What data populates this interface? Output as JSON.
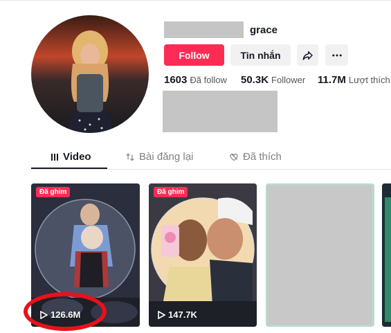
{
  "profile": {
    "username": "grace",
    "follow_label": "Follow",
    "message_label": "Tin nhắn",
    "share_icon": "share-icon",
    "more_icon": "more-icon",
    "stats": [
      {
        "value": "1603",
        "label": "Đã follow"
      },
      {
        "value": "50.3K",
        "label": "Follower"
      },
      {
        "value": "11.7M",
        "label": "Lượt thích"
      }
    ]
  },
  "tabs": [
    {
      "label": "Video",
      "icon": "grid-icon",
      "active": true
    },
    {
      "label": "Bài đăng lại",
      "icon": "repost-icon",
      "active": false
    },
    {
      "label": "Đã thích",
      "icon": "heart-icon",
      "active": false
    }
  ],
  "videos": [
    {
      "pinned_label": "Đã ghim",
      "views": "126.6M"
    },
    {
      "pinned_label": "Đã ghim",
      "views": "147.7K"
    }
  ],
  "colors": {
    "accent": "#fe2c55",
    "annotation": "#e8111b",
    "redacted": "#c5c5c5"
  }
}
